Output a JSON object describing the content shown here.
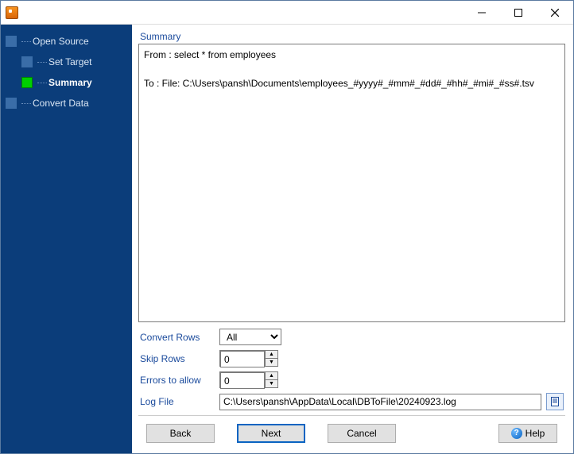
{
  "window": {
    "title": ""
  },
  "win_controls": {
    "min": "—",
    "max": "☐",
    "close": "✕"
  },
  "sidebar": {
    "items": [
      {
        "label": "Open Source",
        "active": false,
        "sub": false
      },
      {
        "label": "Set Target",
        "active": false,
        "sub": true
      },
      {
        "label": "Summary",
        "active": true,
        "sub": true
      },
      {
        "label": "Convert Data",
        "active": false,
        "sub": false
      }
    ]
  },
  "main": {
    "section_label": "Summary",
    "summary_text": "From : select * from employees\n\nTo : File: C:\\Users\\pansh\\Documents\\employees_#yyyy#_#mm#_#dd#_#hh#_#mi#_#ss#.tsv"
  },
  "form": {
    "convert_rows": {
      "label": "Convert Rows",
      "value": "All",
      "options": [
        "All"
      ]
    },
    "skip_rows": {
      "label": "Skip Rows",
      "value": "0"
    },
    "errors_allow": {
      "label": "Errors to allow",
      "value": "0"
    },
    "log_file": {
      "label": "Log File",
      "value": "C:\\Users\\pansh\\AppData\\Local\\DBToFile\\20240923.log"
    }
  },
  "footer": {
    "back": "Back",
    "next": "Next",
    "cancel": "Cancel",
    "help": "Help"
  }
}
